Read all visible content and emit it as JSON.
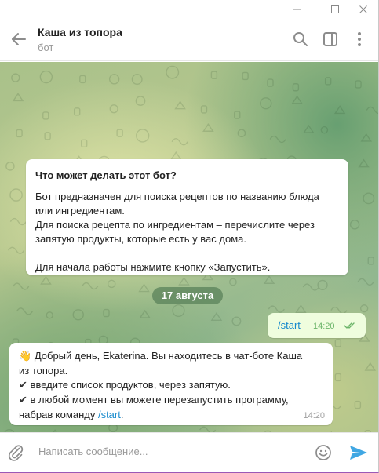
{
  "window": {
    "controls": [
      "minimize",
      "maximize",
      "close"
    ]
  },
  "header": {
    "title": "Каша из топора",
    "subtitle": "бот",
    "icons": [
      "back-arrow-icon",
      "search-icon",
      "sidebar-toggle-icon",
      "more-vertical-icon"
    ]
  },
  "card": {
    "title": "Что может делать этот бот?",
    "lines": [
      "Бот предназначен для поиска рецептов по названию блюда",
      "или ингредиентам.",
      "Для поиска рецепта по ингредиентам – перечислите через",
      "запятую продукты, которые есть у вас дома."
    ],
    "footer": "Для начала работы нажмите кнопку «Запустить»."
  },
  "date_label": "17 августа",
  "outgoing": {
    "text": "/start",
    "time": "14:20",
    "status": "read"
  },
  "incoming": {
    "emoji": "👋",
    "line1": "Добрый день, Ekaterina. Вы находитесь в чат-боте Каша",
    "line2": "из топора.",
    "check": "✔",
    "line3": "введите список продуктов, через запятую.",
    "line4": "в любой момент вы можете перезапустить программу,",
    "line5_prefix": "набрав команду ",
    "line5_link": "/start",
    "line5_suffix": ".",
    "time": "14:20"
  },
  "composer": {
    "placeholder": "Написать сообщение..."
  },
  "colors": {
    "accent": "#168acd",
    "outgoing_bg": "#effdde",
    "read_ticks": "#6cb56a"
  }
}
